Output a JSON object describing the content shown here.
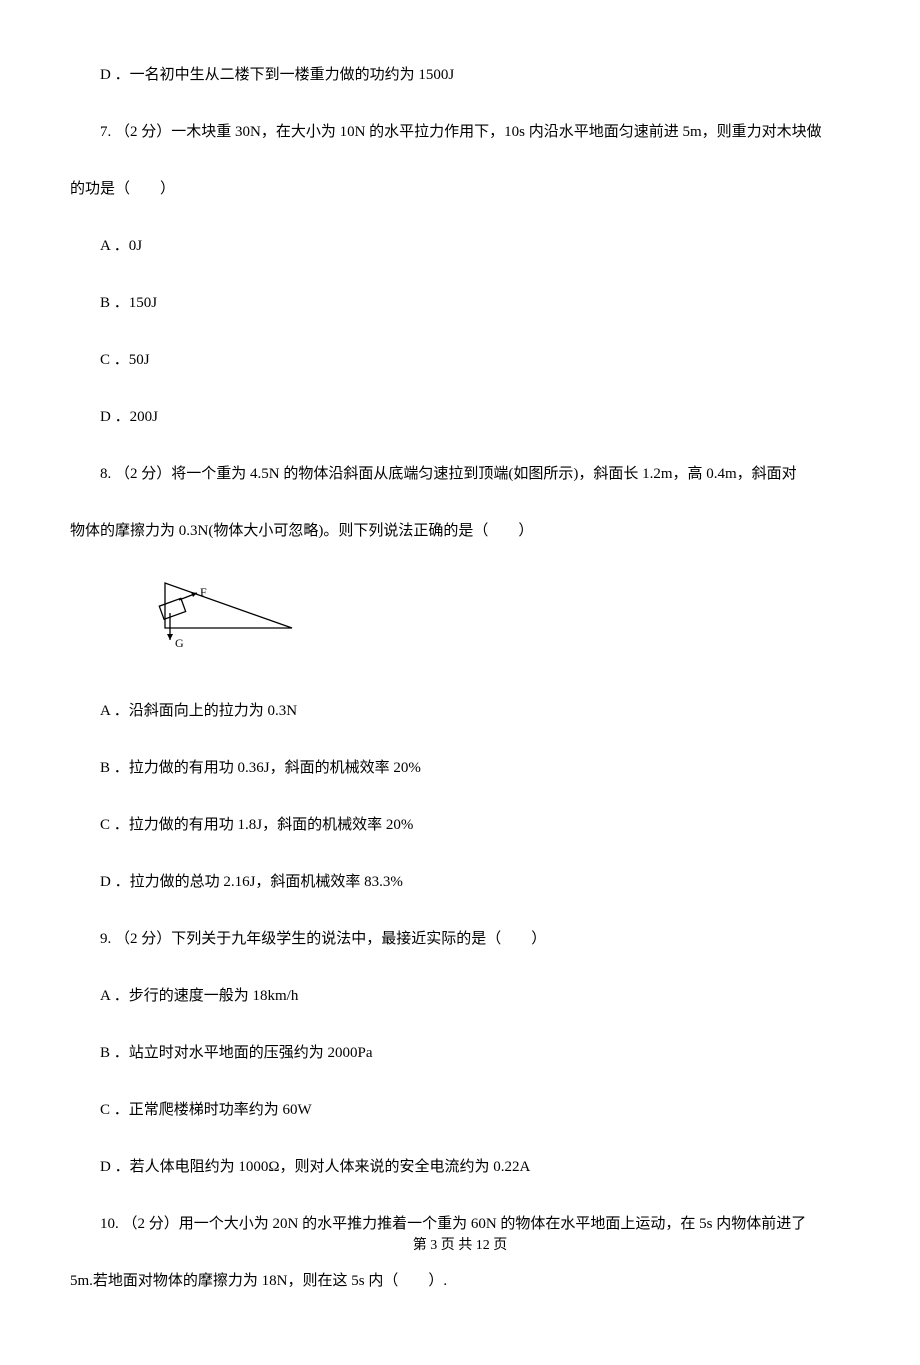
{
  "q6": {
    "optD": "D ．一名初中生从二楼下到一楼重力做的功约为 1500J"
  },
  "q7": {
    "stem_line1": "7. （2 分）一木块重 30N，在大小为 10N 的水平拉力作用下，10s 内沿水平地面匀速前进 5m，则重力对木块做",
    "stem_line2": "的功是（　　）",
    "optA": "A ．0J",
    "optB": "B ．150J",
    "optC": "C ．50J",
    "optD": "D ．200J"
  },
  "q8": {
    "stem_line1": "8. （2 分）将一个重为 4.5N 的物体沿斜面从底端匀速拉到顶端(如图所示)，斜面长 1.2m，高 0.4m，斜面对",
    "stem_line2": "物体的摩擦力为 0.3N(物体大小可忽略)。则下列说法正确的是（　　）",
    "diagram_label_f": "F",
    "diagram_label_g": "G",
    "optA": "A ．沿斜面向上的拉力为 0.3N",
    "optB": "B ．拉力做的有用功 0.36J，斜面的机械效率 20%",
    "optC": "C ．拉力做的有用功 1.8J，斜面的机械效率 20%",
    "optD": "D ．拉力做的总功 2.16J，斜面机械效率 83.3%"
  },
  "q9": {
    "stem": "9. （2 分）下列关于九年级学生的说法中，最接近实际的是（　　）",
    "optA": "A ．步行的速度一般为 18km/h",
    "optB": "B ．站立时对水平地面的压强约为 2000Pa",
    "optC": "C ．正常爬楼梯时功率约为 60W",
    "optD": "D ．若人体电阻约为 1000Ω，则对人体来说的安全电流约为 0.22A"
  },
  "q10": {
    "stem_line1": "10. （2 分）用一个大小为 20N 的水平推力推着一个重为 60N 的物体在水平地面上运动，在 5s 内物体前进了",
    "stem_line2": "5m.若地面对物体的摩擦力为 18N，则在这 5s 内（　　）."
  },
  "footer": "第 3 页 共 12 页"
}
